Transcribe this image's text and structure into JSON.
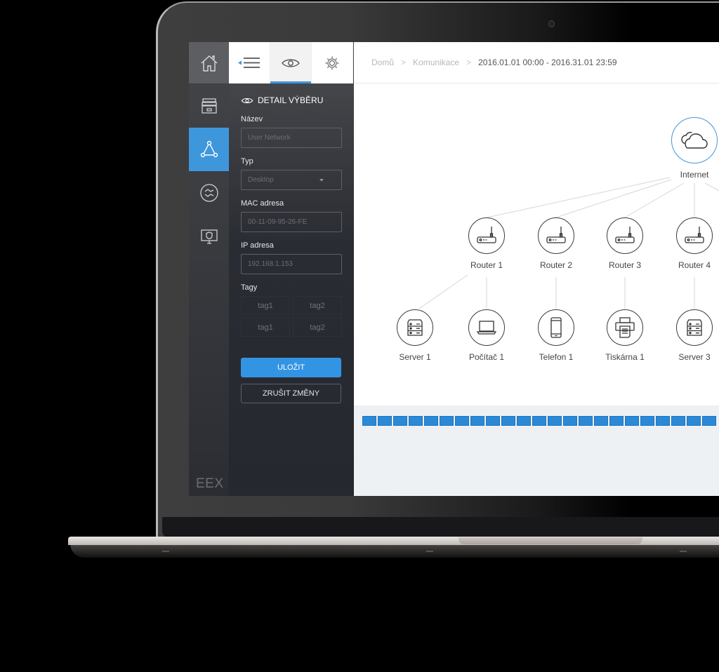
{
  "app": {
    "logo": "EEX"
  },
  "rail": {
    "items": [
      {
        "id": "home",
        "icon": "home-icon",
        "active": false
      },
      {
        "id": "storage",
        "icon": "archive-icon",
        "active": false
      },
      {
        "id": "network",
        "icon": "network-triangle-icon",
        "active": true
      },
      {
        "id": "exchange",
        "icon": "exchange-icon",
        "active": false
      },
      {
        "id": "monitor",
        "icon": "monitor-shield-icon",
        "active": false
      }
    ]
  },
  "panel": {
    "tabs": [
      {
        "id": "collapse",
        "icon": "menu-collapse-icon",
        "active": false
      },
      {
        "id": "detail",
        "icon": "eye-icon",
        "active": true
      },
      {
        "id": "settings",
        "icon": "gear-icon",
        "active": false
      }
    ],
    "title": "DETAIL VÝBĚRU",
    "fields": {
      "name": {
        "label": "Název",
        "placeholder": "User Network"
      },
      "type": {
        "label": "Typ",
        "value": "Desktop"
      },
      "mac": {
        "label": "MAC adresa",
        "placeholder": "00-11-09-95-26-FE"
      },
      "ip": {
        "label": "IP adresa",
        "placeholder": "192.168.1.153"
      }
    },
    "tags_label": "Tagy",
    "tags": [
      "tag1",
      "tag2",
      "tag1",
      "tag2"
    ],
    "save_label": "ULOŽIT",
    "cancel_label": "ZRUŠIT ZMĚNY"
  },
  "breadcrumb": {
    "items": [
      "Domů",
      "Komunikace"
    ],
    "current": "2016.01.01 00:00 - 2016.31.01 23:59"
  },
  "graph": {
    "root": {
      "label": "Internet",
      "icon": "cloud-icon"
    },
    "routers": [
      {
        "label": "Router 1",
        "icon": "router-icon"
      },
      {
        "label": "Router 2",
        "icon": "router-icon"
      },
      {
        "label": "Router 3",
        "icon": "router-icon"
      },
      {
        "label": "Router 4",
        "icon": "router-icon"
      }
    ],
    "devices": [
      {
        "label": "Server 1",
        "icon": "server-icon"
      },
      {
        "label": "Počítač 1",
        "icon": "laptop-icon"
      },
      {
        "label": "Telefon 1",
        "icon": "phone-icon"
      },
      {
        "label": "Tiskárna 1",
        "icon": "printer-icon"
      },
      {
        "label": "Server 3",
        "icon": "server-icon"
      }
    ]
  },
  "timeline": {
    "block_count": 23,
    "color": "#2a8ad9"
  },
  "colors": {
    "accent": "#3f97db",
    "save": "#3494e4"
  }
}
